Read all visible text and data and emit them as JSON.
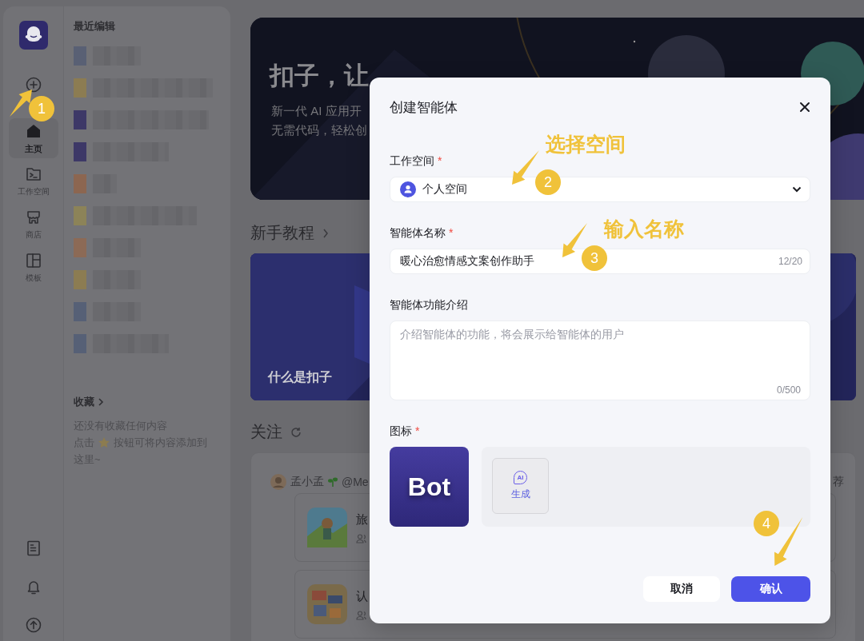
{
  "nav": {
    "items": [
      {
        "label": "主页",
        "selected": true
      },
      {
        "label": "工作空间",
        "selected": false
      },
      {
        "label": "商店",
        "selected": false
      },
      {
        "label": "模板",
        "selected": false
      }
    ]
  },
  "recent": {
    "title": "最近编辑",
    "items": [
      {
        "color": "#596074"
      },
      {
        "color": "#8c7c52"
      },
      {
        "color": "#3d3867"
      },
      {
        "color": "#3d3867"
      },
      {
        "color": "#8c6650"
      },
      {
        "color": "#8c8358"
      },
      {
        "color": "#8c6a56"
      },
      {
        "color": "#8c7c52"
      },
      {
        "color": "#566076"
      },
      {
        "color": "#566076"
      }
    ]
  },
  "favorites": {
    "title": "收藏",
    "empty_text": "还没有收藏任何内容",
    "hint_before": "点击",
    "hint_after": "按钮可将内容添加到",
    "hint_end": "这里~"
  },
  "hero": {
    "title": "扣子，让",
    "lines": [
      "新一代 AI 应用开",
      "无需代码，轻松创"
    ]
  },
  "tutorial": {
    "title": "新手教程",
    "cards": [
      {
        "title": "什么是扣子"
      }
    ]
  },
  "follow": {
    "title": "关注",
    "author": "孟小孟",
    "handle": "@Me",
    "side_text": "荐",
    "posts": [
      {
        "title": "旅"
      },
      {
        "title": "认"
      }
    ]
  },
  "dialog": {
    "title": "创建智能体",
    "fields": [
      {
        "kind": "select",
        "label": "工作空间",
        "mark": "*",
        "value": "个人空间"
      },
      {
        "kind": "text",
        "label": "智能体名称",
        "mark": "*",
        "value": "暖心治愈情感文案创作助手",
        "counter": "12/20"
      },
      {
        "kind": "textarea",
        "label": "智能体功能介绍",
        "placeholder": "介绍智能体的功能，将会展示给智能体的用户",
        "counter": "0/500"
      },
      {
        "kind": "icon",
        "label": "图标",
        "mark": "*",
        "preview": "Bot",
        "badge": "AI",
        "action": "生成"
      }
    ],
    "buttons": [
      {
        "label": "取消",
        "kind": "secondary"
      },
      {
        "label": "确认",
        "kind": "primary"
      }
    ]
  },
  "guides": [
    {
      "number": "1"
    },
    {
      "number": "2",
      "label": "选择空间"
    },
    {
      "number": "3",
      "label": "输入名称"
    },
    {
      "number": "4"
    }
  ]
}
